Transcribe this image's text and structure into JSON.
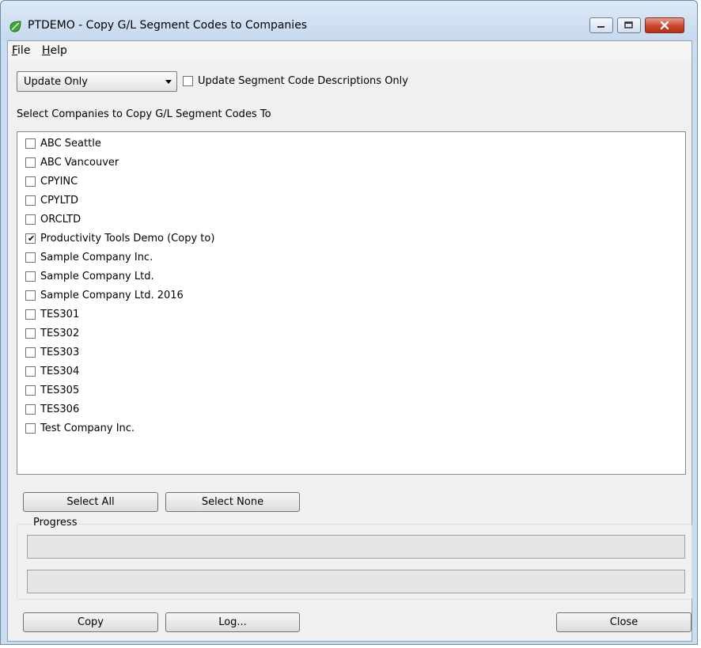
{
  "window": {
    "title": "PTDEMO - Copy G/L Segment Codes to Companies",
    "accent_color": "#c9dcf0",
    "close_color": "#c8452d"
  },
  "menu": {
    "file": "File",
    "help": "Help"
  },
  "mode_select": {
    "value": "Update Only"
  },
  "update_desc_only": {
    "label": "Update Segment Code Descriptions Only",
    "checked": false
  },
  "companies_label": "Select Companies to Copy G/L Segment Codes To",
  "companies": [
    {
      "label": "ABC Seattle",
      "checked": false
    },
    {
      "label": "ABC Vancouver",
      "checked": false
    },
    {
      "label": "CPYINC",
      "checked": false
    },
    {
      "label": "CPYLTD",
      "checked": false
    },
    {
      "label": "ORCLTD",
      "checked": false
    },
    {
      "label": "Productivity Tools Demo (Copy to)",
      "checked": true
    },
    {
      "label": "Sample Company Inc.",
      "checked": false
    },
    {
      "label": "Sample Company Ltd.",
      "checked": false
    },
    {
      "label": "Sample Company Ltd. 2016",
      "checked": false
    },
    {
      "label": "TES301",
      "checked": false
    },
    {
      "label": "TES302",
      "checked": false
    },
    {
      "label": "TES303",
      "checked": false
    },
    {
      "label": "TES304",
      "checked": false
    },
    {
      "label": "TES305",
      "checked": false
    },
    {
      "label": "TES306",
      "checked": false
    },
    {
      "label": "Test Company Inc.",
      "checked": false
    }
  ],
  "buttons": {
    "select_all": "Select All",
    "select_none": "Select None",
    "copy": "Copy",
    "log": "Log...",
    "close": "Close"
  },
  "progress": {
    "label": "Progress",
    "bar1": 0,
    "bar2": 0
  },
  "icons": {
    "app": "app-leaf-icon",
    "minimize": "minimize-icon",
    "maximize": "maximize-icon",
    "close": "close-icon",
    "dropdown": "chevron-down-icon",
    "check": "check-icon"
  }
}
